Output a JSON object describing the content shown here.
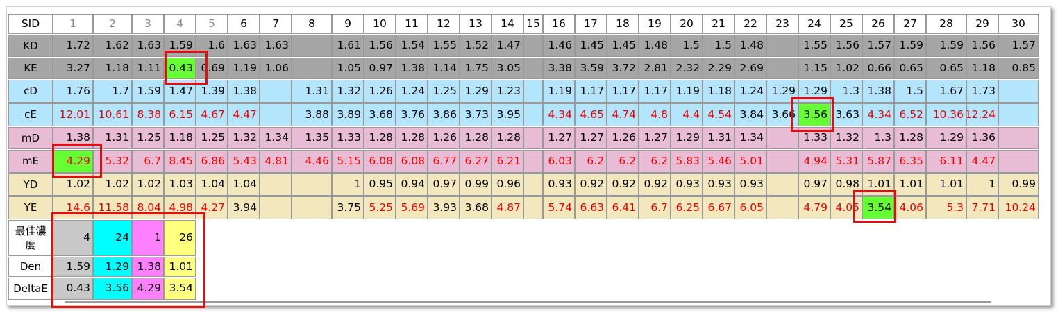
{
  "table": {
    "row_label_header": "SID",
    "columns": [
      "1",
      "2",
      "3",
      "4",
      "5",
      "6",
      "7",
      "8",
      "9",
      "10",
      "11",
      "12",
      "13",
      "14",
      "15",
      "16",
      "17",
      "18",
      "19",
      "20",
      "21",
      "22",
      "23",
      "24",
      "25",
      "26",
      "27",
      "28",
      "29",
      "30"
    ],
    "gray_column_headers": [
      "1",
      "2",
      "3",
      "4",
      "5"
    ],
    "rows": [
      {
        "key": "KD",
        "label": "KD",
        "bg": "#a6a6a6",
        "values": [
          "1.72",
          "1.62",
          "1.63",
          "1.59",
          "1.6",
          "1.63",
          "1.63",
          "",
          "1.61",
          "1.56",
          "1.54",
          "1.55",
          "1.52",
          "1.47",
          "",
          "1.46",
          "1.45",
          "1.45",
          "1.48",
          "1.5",
          "1.5",
          "1.48",
          "",
          "1.55",
          "1.56",
          "1.57",
          "1.59",
          "1.59",
          "1.56",
          "1.57"
        ],
        "red": []
      },
      {
        "key": "KE",
        "label": "KE",
        "bg": "#a6a6a6",
        "values": [
          "3.27",
          "1.18",
          "1.11",
          "0.43",
          "0.69",
          "1.19",
          "1.06",
          "",
          "1.05",
          "0.97",
          "1.38",
          "1.14",
          "1.75",
          "3.05",
          "",
          "3.38",
          "3.59",
          "3.72",
          "2.81",
          "2.32",
          "2.29",
          "2.69",
          "",
          "1.15",
          "1.02",
          "0.66",
          "0.65",
          "0.65",
          "1.18",
          "0.85"
        ],
        "red": []
      },
      {
        "key": "cD",
        "label": "cD",
        "bg": "#b3e5fc",
        "values": [
          "1.76",
          "1.7",
          "1.59",
          "1.47",
          "1.39",
          "1.38",
          "",
          "1.31",
          "1.32",
          "1.26",
          "1.24",
          "1.25",
          "1.29",
          "1.23",
          "",
          "1.19",
          "1.17",
          "1.17",
          "1.17",
          "1.19",
          "1.18",
          "1.24",
          "1.29",
          "1.29",
          "1.3",
          "1.38",
          "1.5",
          "1.67",
          "1.73",
          ""
        ],
        "red": []
      },
      {
        "key": "cE",
        "label": "cE",
        "bg": "#b3e5fc",
        "values": [
          "12.01",
          "10.61",
          "8.38",
          "6.15",
          "4.67",
          "4.47",
          "",
          "3.88",
          "3.89",
          "3.68",
          "3.76",
          "3.86",
          "3.73",
          "3.95",
          "",
          "4.34",
          "4.65",
          "4.74",
          "4.8",
          "4.4",
          "4.54",
          "3.84",
          "3.66",
          "3.56",
          "3.63",
          "4.34",
          "6.52",
          "10.36",
          "12.24",
          ""
        ],
        "red": [
          "1",
          "2",
          "3",
          "4",
          "5",
          "6",
          "16",
          "17",
          "18",
          "19",
          "20",
          "21",
          "26",
          "27",
          "28",
          "29"
        ]
      },
      {
        "key": "mD",
        "label": "mD",
        "bg": "#e8bcd4",
        "values": [
          "1.38",
          "1.31",
          "1.25",
          "1.18",
          "1.25",
          "1.32",
          "1.34",
          "1.35",
          "1.33",
          "1.28",
          "1.28",
          "1.26",
          "1.28",
          "1.28",
          "",
          "1.27",
          "1.27",
          "1.26",
          "1.27",
          "1.29",
          "1.31",
          "1.34",
          "",
          "1.33",
          "1.32",
          "1.3",
          "1.28",
          "1.29",
          "1.36",
          ""
        ],
        "red": []
      },
      {
        "key": "mE",
        "label": "mE",
        "bg": "#e8bcd4",
        "values": [
          "4.29",
          "5.32",
          "6.7",
          "8.45",
          "6.86",
          "5.43",
          "4.81",
          "4.46",
          "5.15",
          "6.08",
          "6.08",
          "6.77",
          "6.27",
          "6.21",
          "",
          "6.03",
          "6.2",
          "6.2",
          "6.2",
          "5.83",
          "5.46",
          "5.01",
          "",
          "4.94",
          "5.31",
          "5.87",
          "6.35",
          "6.11",
          "4.47",
          ""
        ],
        "red": [
          "1",
          "2",
          "3",
          "4",
          "5",
          "6",
          "7",
          "8",
          "9",
          "10",
          "11",
          "12",
          "13",
          "14",
          "16",
          "17",
          "18",
          "19",
          "20",
          "21",
          "22",
          "24",
          "25",
          "26",
          "27",
          "28",
          "29"
        ]
      },
      {
        "key": "YD",
        "label": "YD",
        "bg": "#f3e7bd",
        "values": [
          "1.02",
          "1.02",
          "1.02",
          "1.03",
          "1.04",
          "1.04",
          "",
          "",
          "1",
          "0.95",
          "0.94",
          "0.97",
          "0.99",
          "0.96",
          "",
          "0.93",
          "0.92",
          "0.92",
          "0.92",
          "0.93",
          "0.93",
          "0.93",
          "",
          "0.97",
          "0.98",
          "1.01",
          "1.01",
          "1.01",
          "1",
          "0.99"
        ],
        "red": []
      },
      {
        "key": "YE",
        "label": "YE",
        "bg": "#f3e7bd",
        "values": [
          "14.6",
          "11.58",
          "8.04",
          "4.98",
          "4.27",
          "3.94",
          "",
          "",
          "3.75",
          "5.25",
          "5.69",
          "3.93",
          "3.68",
          "4.87",
          "",
          "5.74",
          "6.63",
          "6.41",
          "6.7",
          "6.25",
          "6.67",
          "6.05",
          "",
          "4.79",
          "4.05",
          "3.54",
          "4.06",
          "5.3",
          "7.71",
          "10.24"
        ],
        "red": [
          "1",
          "2",
          "3",
          "4",
          "5",
          "10",
          "11",
          "14",
          "16",
          "17",
          "18",
          "19",
          "20",
          "21",
          "22",
          "24",
          "25",
          "27",
          "28",
          "29",
          "30"
        ]
      }
    ],
    "highlights": [
      {
        "row": "KE",
        "col": "4"
      },
      {
        "row": "cE",
        "col": "24"
      },
      {
        "row": "mE",
        "col": "1"
      },
      {
        "row": "YE",
        "col": "26"
      }
    ]
  },
  "summary": {
    "rows": [
      {
        "label": "最佳濃度",
        "values": [
          "4",
          "24",
          "1",
          "26"
        ]
      },
      {
        "label": "Den",
        "values": [
          "1.59",
          "1.29",
          "1.38",
          "1.01"
        ]
      },
      {
        "label": "DeltaE",
        "values": [
          "0.43",
          "3.56",
          "4.29",
          "3.54"
        ]
      }
    ],
    "column_colors": [
      "#c8c8c8",
      "#00ffff",
      "#ff80ff",
      "#ffff80"
    ]
  },
  "colors": {
    "red_text": "#ee0000",
    "highlight": "#66ff33",
    "annotation_box": "#e01010"
  }
}
